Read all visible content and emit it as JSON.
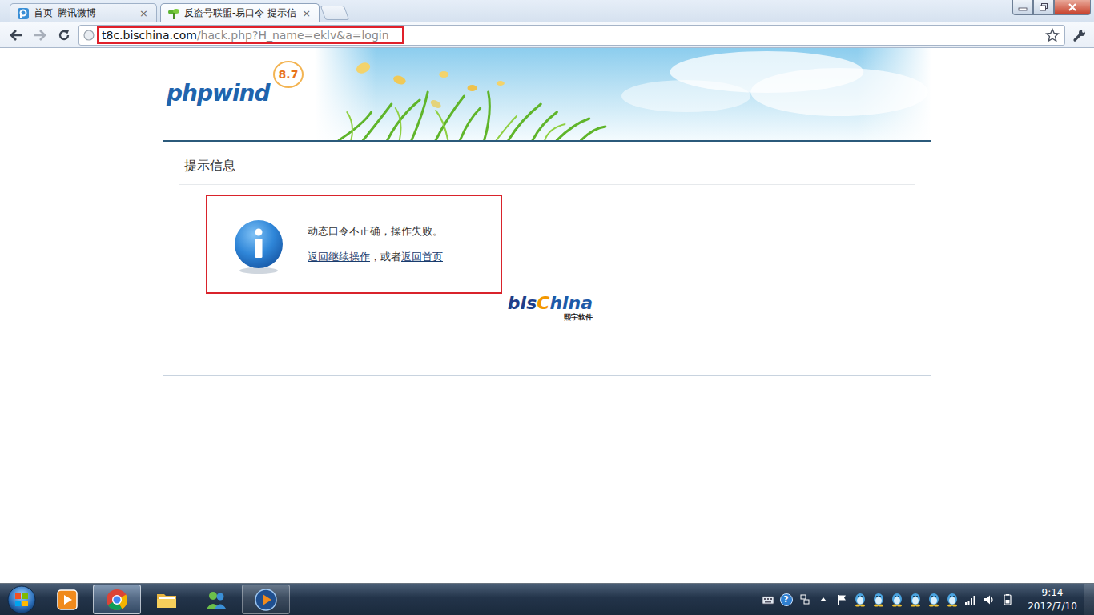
{
  "tabs": [
    {
      "label": "首页_腾讯微博",
      "close": "×",
      "selected": false
    },
    {
      "label": "反盗号联盟-易口令 提示信",
      "close": "×",
      "selected": true
    }
  ],
  "address": {
    "host": "t8c.bischina.com",
    "path": "/hack.php?H_name=eklv&a=login",
    "highlighted": true
  },
  "page": {
    "logo": "phpwind",
    "version": "8.7",
    "panel_title": "提示信息",
    "message": "动态口令不正确，操作失败。",
    "links": [
      {
        "label": "返回继续操作"
      },
      {
        "label": "返回首页"
      }
    ],
    "separator": "，或者",
    "highlighted": true,
    "brand": {
      "prefix": "bis",
      "mark": "C",
      "suffix": "hina",
      "sub": "熙宇软件"
    }
  },
  "taskbar": {
    "apps": [
      {
        "kind": "media",
        "running": false,
        "selected": false
      },
      {
        "kind": "chrome",
        "running": true,
        "selected": true
      },
      {
        "kind": "explorer",
        "running": false,
        "selected": false
      },
      {
        "kind": "messenger",
        "running": false,
        "selected": false
      },
      {
        "kind": "player",
        "running": true,
        "selected": false
      }
    ],
    "tray": [
      {
        "kind": "keyboard"
      },
      {
        "kind": "help",
        "glyph": "?"
      },
      {
        "kind": "ime"
      },
      {
        "kind": "expand"
      },
      {
        "kind": "flag"
      },
      {
        "kind": "qq"
      },
      {
        "kind": "qq"
      },
      {
        "kind": "qq"
      },
      {
        "kind": "qq"
      },
      {
        "kind": "qq"
      },
      {
        "kind": "qq"
      },
      {
        "kind": "signal"
      },
      {
        "kind": "volume"
      },
      {
        "kind": "power"
      }
    ],
    "time": "9:14",
    "date": "2012/7/10"
  }
}
